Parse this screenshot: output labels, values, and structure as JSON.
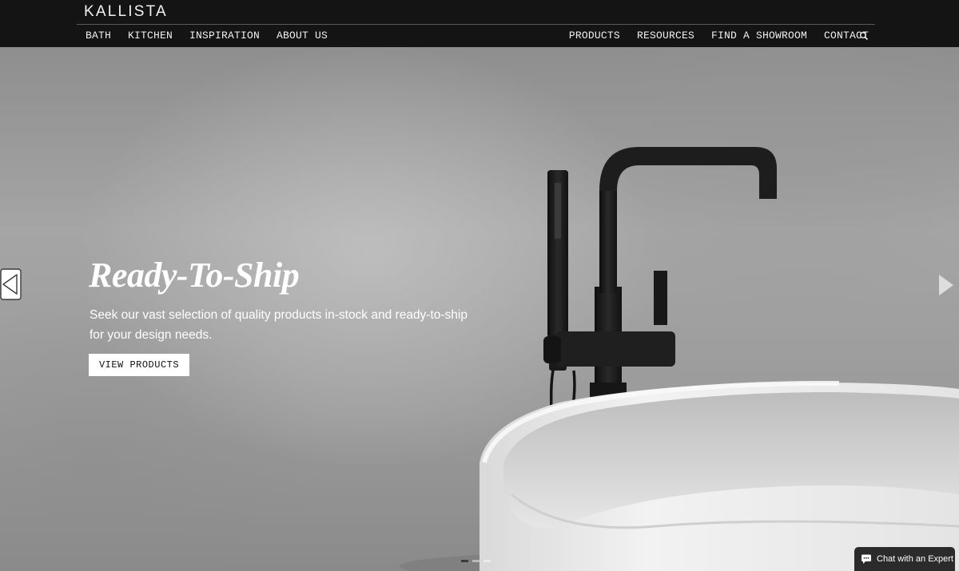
{
  "header": {
    "logo": "KALLISTA",
    "nav_left": [
      "BATH",
      "KITCHEN",
      "INSPIRATION",
      "ABOUT US"
    ],
    "nav_right": [
      "PRODUCTS",
      "RESOURCES",
      "FIND A SHOWROOM",
      "CONTACT"
    ],
    "search_icon": "search-icon"
  },
  "hero": {
    "title": "Ready-To-Ship",
    "description": "Seek our vast selection of quality products in-stock and ready-to-ship for your design needs.",
    "cta_label": "VIEW PRODUCTS",
    "prev_icon": "arrow-left-icon",
    "next_icon": "arrow-right-icon",
    "slides_total": 3,
    "slide_active": 1
  },
  "chat": {
    "label": "Chat with an Expert",
    "icon": "chat-bubble-icon"
  },
  "colors": {
    "header_bg": "#141414",
    "text_light": "#ffffff",
    "fixture_black": "#1b1b1b",
    "tub_white": "#e9e9e9"
  }
}
